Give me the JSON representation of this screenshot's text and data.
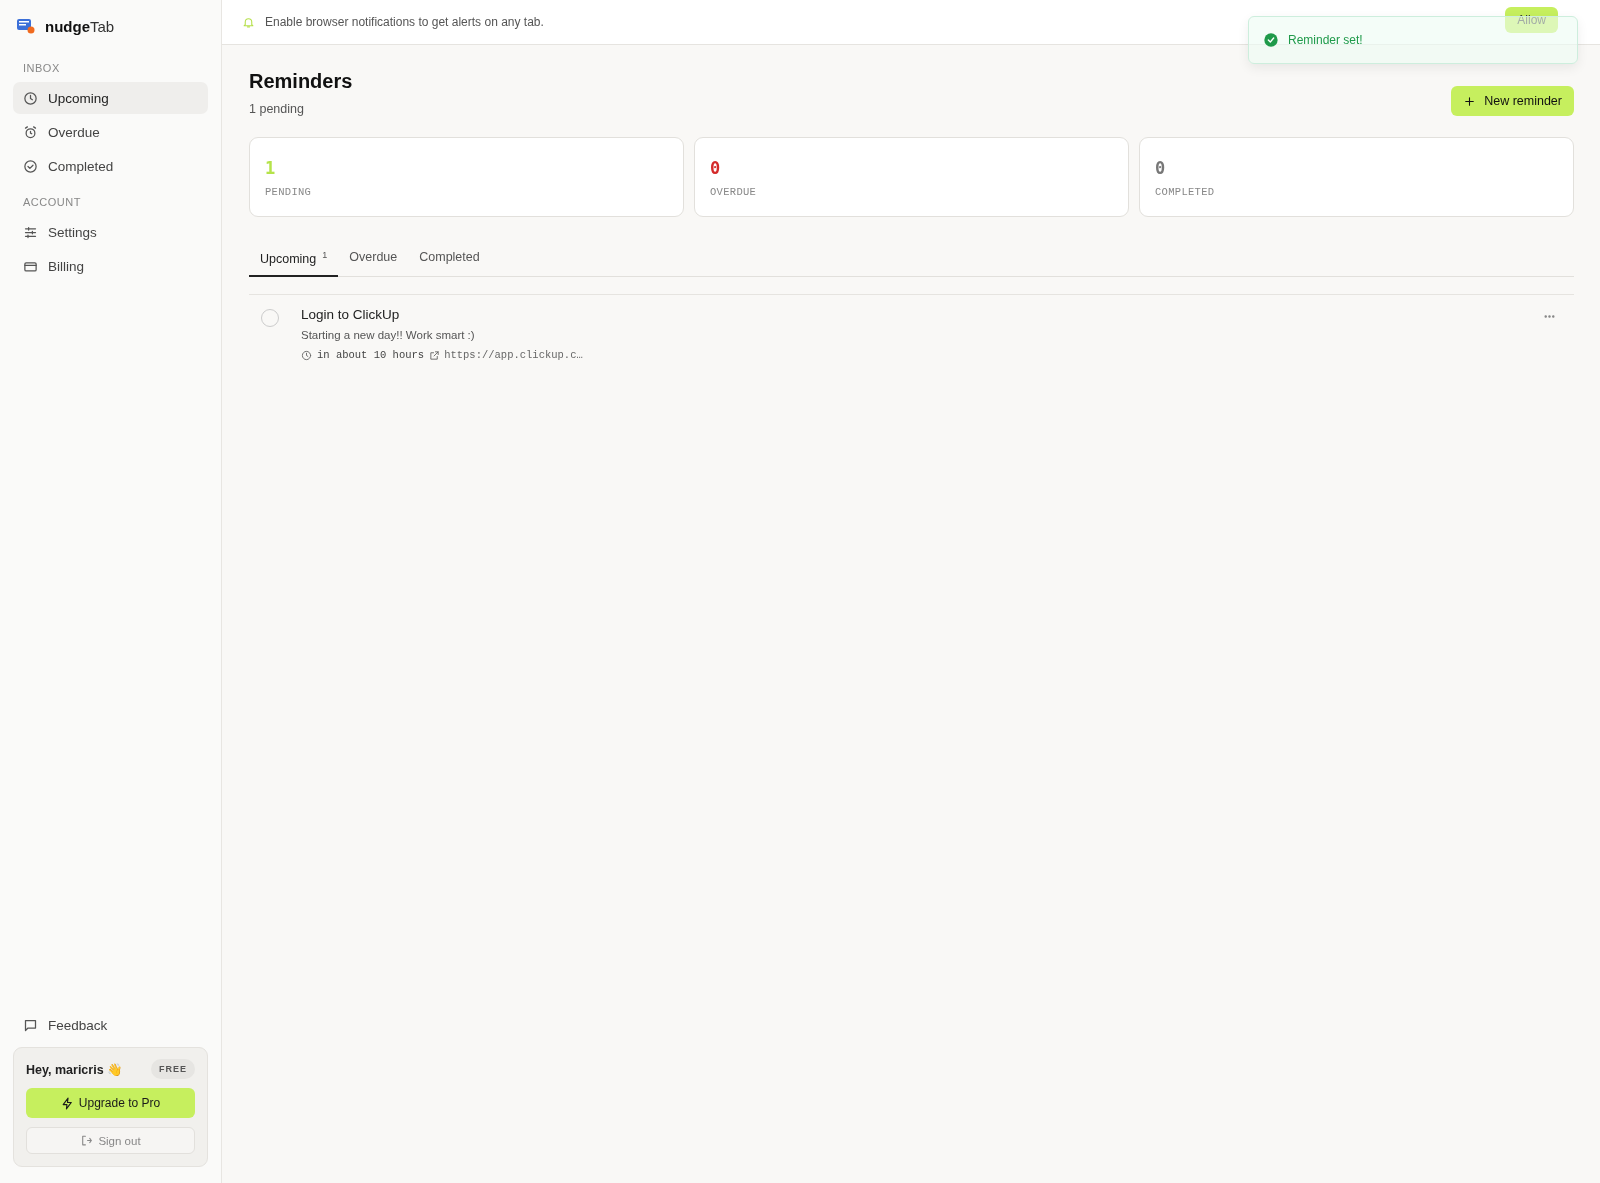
{
  "brand": {
    "name_bold": "nudge",
    "name_rest": "Tab"
  },
  "sidebar": {
    "sections": [
      {
        "heading": "INBOX",
        "items": [
          {
            "label": "Upcoming",
            "selected": true
          },
          {
            "label": "Overdue",
            "selected": false
          },
          {
            "label": "Completed",
            "selected": false
          }
        ]
      },
      {
        "heading": "ACCOUNT",
        "items": [
          {
            "label": "Settings",
            "selected": false
          },
          {
            "label": "Billing",
            "selected": false
          }
        ]
      }
    ],
    "feedback": "Feedback",
    "user_card": {
      "greeting": "Hey, maricris 👋",
      "plan": "FREE",
      "upgrade": "Upgrade to Pro",
      "sign_out": "Sign out"
    }
  },
  "banner": {
    "text": "Enable browser notifications to get alerts on any tab.",
    "button": "Allow"
  },
  "toast": {
    "text": "Reminder set!"
  },
  "page": {
    "title": "Reminders",
    "subtitle": "1 pending",
    "new_button": "New reminder"
  },
  "stats": [
    {
      "value": "1",
      "label": "PENDING",
      "color": "#b5e34a"
    },
    {
      "value": "0",
      "label": "OVERDUE",
      "color": "#d42a2a"
    },
    {
      "value": "0",
      "label": "COMPLETED",
      "color": "#777777"
    }
  ],
  "tabs": [
    {
      "label": "Upcoming",
      "count": "1",
      "selected": true
    },
    {
      "label": "Overdue",
      "selected": false
    },
    {
      "label": "Completed",
      "selected": false
    }
  ],
  "reminders": [
    {
      "title": "Login to ClickUp",
      "note": "Starting a new day!! Work smart :)",
      "when": "in about 10 hours",
      "link": "https://app.clickup.c…",
      "done": false
    }
  ]
}
